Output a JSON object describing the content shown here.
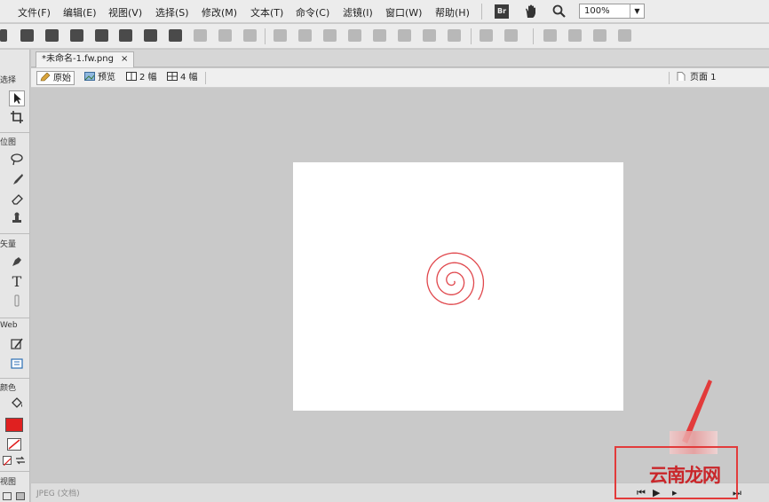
{
  "menu": {
    "items": [
      "文件(F)",
      "编辑(E)",
      "视图(V)",
      "选择(S)",
      "修改(M)",
      "文本(T)",
      "命令(C)",
      "滤镜(I)",
      "窗口(W)",
      "帮助(H)"
    ],
    "br_label": "Br",
    "zoom": "100%"
  },
  "toolbar": {
    "icons": [
      "new-icon",
      "save-icon",
      "open-icon",
      "import-icon",
      "export-icon",
      "print-icon",
      "undo-icon",
      "redo-icon",
      "cut-icon",
      "copy-icon",
      "paste-icon",
      "group-icon",
      "ungroup-icon",
      "join-icon",
      "split-icon",
      "union-icon",
      "intersect-icon",
      "punch-icon",
      "crop-icon",
      "rotate-icon",
      "align-icon",
      "distribute-icon",
      "flip-icon",
      "skew-icon",
      "distort-icon"
    ]
  },
  "tools": {
    "select_header": "选择",
    "bitmap_header": "位图",
    "vector_header": "矢量",
    "web_header": "Web",
    "colors_header": "颜色",
    "view_header": "视图",
    "text_tool": "T"
  },
  "document": {
    "tab_label": "*未命名-1.fw.png",
    "tab_close": "×",
    "views": [
      "原始",
      "预览",
      "2 幅",
      "4 幅"
    ],
    "page_label": "页面 1"
  },
  "status": {
    "format_text": "JPEG (文档)"
  },
  "watermark": {
    "text": "云南龙网"
  },
  "colors": {
    "stroke": "#e02020",
    "annotation": "#e23b3b",
    "spiral": "#e0474c"
  }
}
